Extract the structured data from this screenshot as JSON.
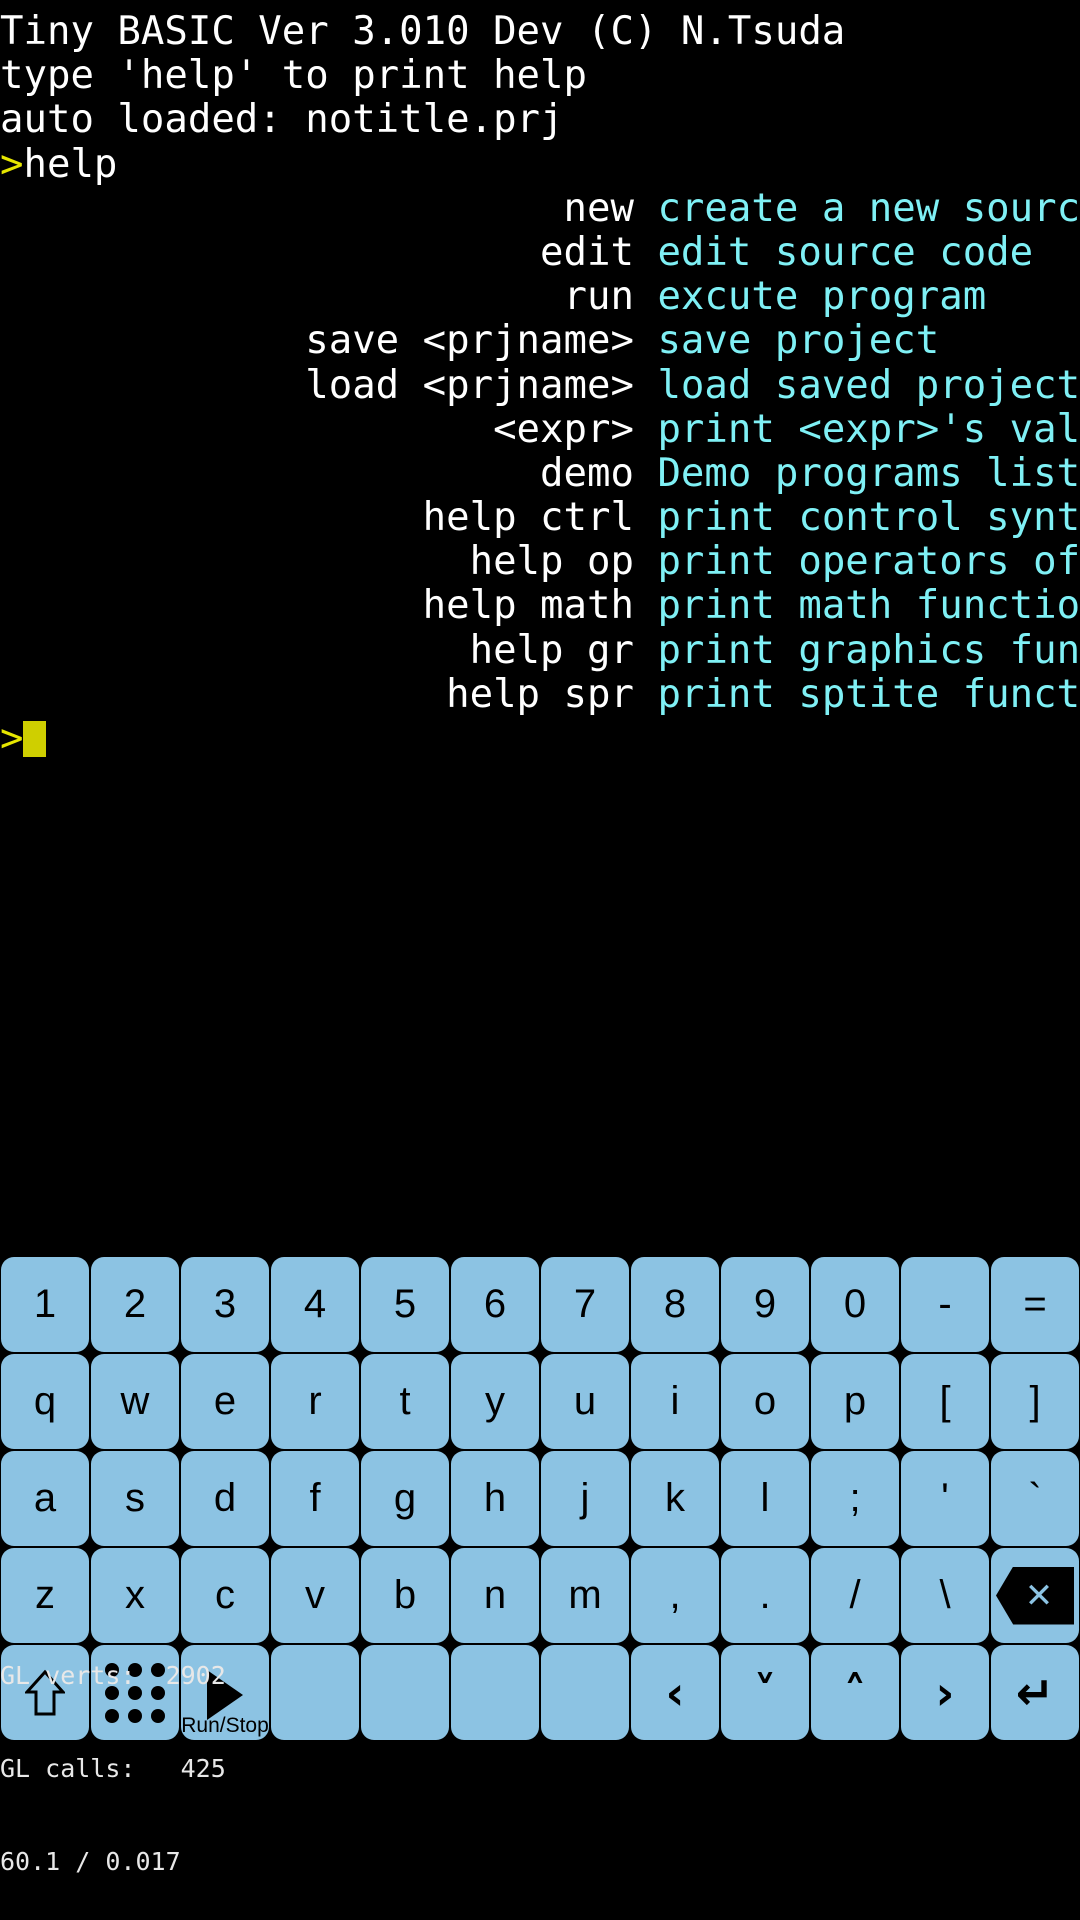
{
  "console": {
    "banner": [
      "Tiny BASIC Ver 3.010 Dev (C) N.Tsuda",
      "type 'help' to print help",
      "auto loaded: notitle.prj"
    ],
    "entered_command": {
      "prompt": ">",
      "text": "help"
    },
    "help_rows": [
      {
        "cmd": "new",
        "desc": "create a new source code"
      },
      {
        "cmd": "edit",
        "desc": "edit source code"
      },
      {
        "cmd": "run",
        "desc": "excute program"
      },
      {
        "cmd": "save <prjname>",
        "desc": "save project"
      },
      {
        "cmd": "load <prjname>",
        "desc": "load saved project"
      },
      {
        "cmd": "<expr>",
        "desc": "print <expr>'s value"
      },
      {
        "cmd": "demo",
        "desc": "Demo programs list"
      },
      {
        "cmd": "help ctrl",
        "desc": "print control syntax"
      },
      {
        "cmd": "help op",
        "desc": "print operators of exp"
      },
      {
        "cmd": "help math",
        "desc": "print math functions"
      },
      {
        "cmd": "help gr",
        "desc": "print graphics functions"
      },
      {
        "cmd": "help spr",
        "desc": "print sptite functions"
      }
    ],
    "active_prompt": ">",
    "colors": {
      "background": "#000000",
      "command_text": "#ffffff",
      "description_text": "#7ff0f5",
      "prompt": "#e6e600",
      "cursor": "#cfcf00"
    }
  },
  "keyboard": {
    "key_color": "#8cc3e3",
    "key_text_color": "#000000",
    "rows": [
      {
        "name": "number-row",
        "keys": [
          {
            "label": "1",
            "name": "key-1"
          },
          {
            "label": "2",
            "name": "key-2"
          },
          {
            "label": "3",
            "name": "key-3"
          },
          {
            "label": "4",
            "name": "key-4"
          },
          {
            "label": "5",
            "name": "key-5"
          },
          {
            "label": "6",
            "name": "key-6"
          },
          {
            "label": "7",
            "name": "key-7"
          },
          {
            "label": "8",
            "name": "key-8"
          },
          {
            "label": "9",
            "name": "key-9"
          },
          {
            "label": "0",
            "name": "key-0"
          },
          {
            "label": "-",
            "name": "key-minus"
          },
          {
            "label": "=",
            "name": "key-equals"
          }
        ]
      },
      {
        "name": "top-letter-row",
        "keys": [
          {
            "label": "q",
            "name": "key-q"
          },
          {
            "label": "w",
            "name": "key-w"
          },
          {
            "label": "e",
            "name": "key-e"
          },
          {
            "label": "r",
            "name": "key-r"
          },
          {
            "label": "t",
            "name": "key-t"
          },
          {
            "label": "y",
            "name": "key-y"
          },
          {
            "label": "u",
            "name": "key-u"
          },
          {
            "label": "i",
            "name": "key-i"
          },
          {
            "label": "o",
            "name": "key-o"
          },
          {
            "label": "p",
            "name": "key-p"
          },
          {
            "label": "[",
            "name": "key-bracket-left"
          },
          {
            "label": "]",
            "name": "key-bracket-right"
          }
        ]
      },
      {
        "name": "home-letter-row",
        "keys": [
          {
            "label": "a",
            "name": "key-a"
          },
          {
            "label": "s",
            "name": "key-s"
          },
          {
            "label": "d",
            "name": "key-d"
          },
          {
            "label": "f",
            "name": "key-f"
          },
          {
            "label": "g",
            "name": "key-g"
          },
          {
            "label": "h",
            "name": "key-h"
          },
          {
            "label": "j",
            "name": "key-j"
          },
          {
            "label": "k",
            "name": "key-k"
          },
          {
            "label": "l",
            "name": "key-l"
          },
          {
            "label": ";",
            "name": "key-semicolon"
          },
          {
            "label": "'",
            "name": "key-apostrophe"
          },
          {
            "label": "`",
            "name": "key-backtick"
          }
        ]
      },
      {
        "name": "bottom-letter-row",
        "keys": [
          {
            "label": "z",
            "name": "key-z"
          },
          {
            "label": "x",
            "name": "key-x"
          },
          {
            "label": "c",
            "name": "key-c"
          },
          {
            "label": "v",
            "name": "key-v"
          },
          {
            "label": "b",
            "name": "key-b"
          },
          {
            "label": "n",
            "name": "key-n"
          },
          {
            "label": "m",
            "name": "key-m"
          },
          {
            "label": ",",
            "name": "key-comma"
          },
          {
            "label": ".",
            "name": "key-period"
          },
          {
            "label": "/",
            "name": "key-slash"
          },
          {
            "label": "\\",
            "name": "key-backslash"
          },
          {
            "label": "",
            "name": "key-backspace",
            "icon": "backspace-icon"
          }
        ]
      },
      {
        "name": "function-row",
        "keys": [
          {
            "label": "",
            "name": "key-shift",
            "icon": "shift-up-arrow-icon"
          },
          {
            "label": "",
            "name": "key-symbols",
            "icon": "dot-grid-icon"
          },
          {
            "label": "Run/Stop",
            "name": "key-run-stop",
            "icon": "play-triangle-icon"
          },
          {
            "label": "",
            "name": "key-blank-1"
          },
          {
            "label": "",
            "name": "key-blank-2"
          },
          {
            "label": "",
            "name": "key-blank-3"
          },
          {
            "label": "",
            "name": "key-blank-4"
          },
          {
            "label": "‹",
            "name": "key-arrow-left",
            "icon": "chevron-left-icon"
          },
          {
            "label": "˅",
            "name": "key-arrow-down",
            "icon": "chevron-down-icon"
          },
          {
            "label": "˄",
            "name": "key-arrow-up",
            "icon": "chevron-up-icon"
          },
          {
            "label": "›",
            "name": "key-arrow-right",
            "icon": "chevron-right-icon"
          },
          {
            "label": "↵",
            "name": "key-enter",
            "icon": "enter-return-icon"
          }
        ]
      }
    ]
  },
  "stats": {
    "verts_label": "GL verts:",
    "verts_value": "2902",
    "calls_label": "GL calls:",
    "calls_value": "425",
    "fps_line": "60.1 / 0.017"
  }
}
